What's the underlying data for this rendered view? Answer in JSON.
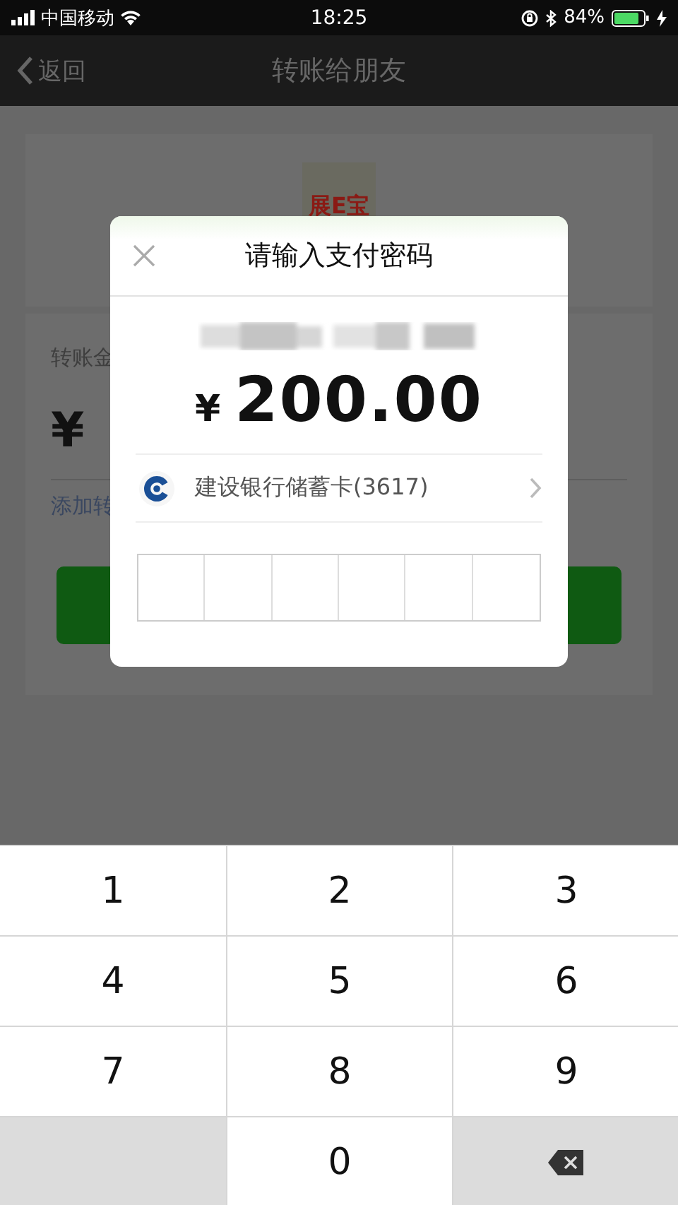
{
  "status_bar": {
    "carrier": "中国移动",
    "time": "18:25",
    "battery": "84%"
  },
  "nav": {
    "back": "返回",
    "title": "转账给朋友"
  },
  "background": {
    "avatar_text": "展E宝",
    "amount_label": "转账金",
    "currency": "¥",
    "note_link": "添加转"
  },
  "dialog": {
    "title": "请输入支付密码",
    "currency": "¥",
    "amount": "200.00",
    "payment_method": "建设银行储蓄卡(3617)",
    "pin_cells": [
      {
        "filled": false
      },
      {
        "filled": false
      },
      {
        "filled": false
      },
      {
        "filled": false
      },
      {
        "filled": false
      },
      {
        "filled": false
      }
    ]
  },
  "keypad": {
    "keys": [
      {
        "kind": "digit",
        "label": "1"
      },
      {
        "kind": "digit",
        "label": "2"
      },
      {
        "kind": "digit",
        "label": "3"
      },
      {
        "kind": "digit",
        "label": "4"
      },
      {
        "kind": "digit",
        "label": "5"
      },
      {
        "kind": "digit",
        "label": "6"
      },
      {
        "kind": "digit",
        "label": "7"
      },
      {
        "kind": "digit",
        "label": "8"
      },
      {
        "kind": "digit",
        "label": "9"
      },
      {
        "kind": "blank"
      },
      {
        "kind": "digit",
        "label": "0"
      },
      {
        "kind": "delete"
      }
    ]
  }
}
